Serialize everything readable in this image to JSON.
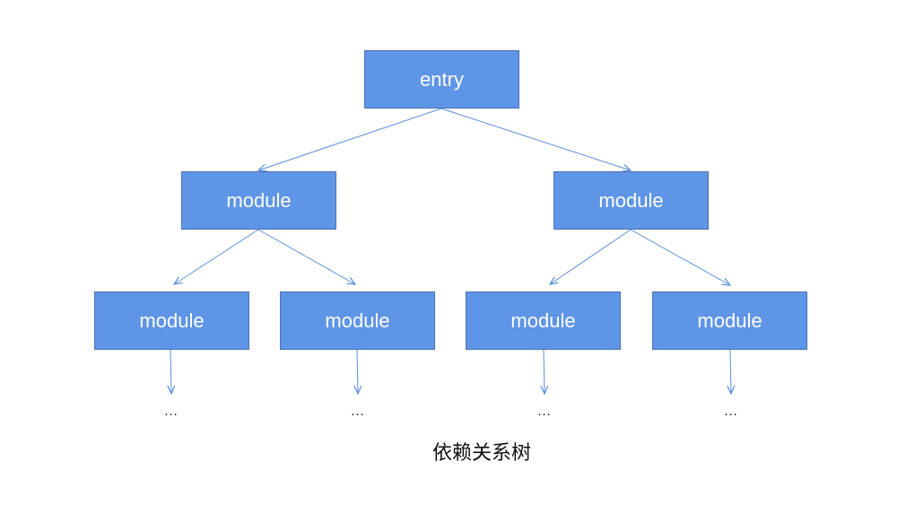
{
  "diagram": {
    "root": {
      "label": "entry"
    },
    "level1": [
      {
        "label": "module"
      },
      {
        "label": "module"
      }
    ],
    "level2": [
      {
        "label": "module"
      },
      {
        "label": "module"
      },
      {
        "label": "module"
      },
      {
        "label": "module"
      }
    ],
    "continuations": [
      "…",
      "…",
      "…",
      "…"
    ],
    "caption": "依赖关系树",
    "colors": {
      "node_fill": "#5f95e6",
      "node_border": "#4a72b0",
      "node_text": "#ffffff",
      "edge": "#5b8fd9"
    }
  }
}
